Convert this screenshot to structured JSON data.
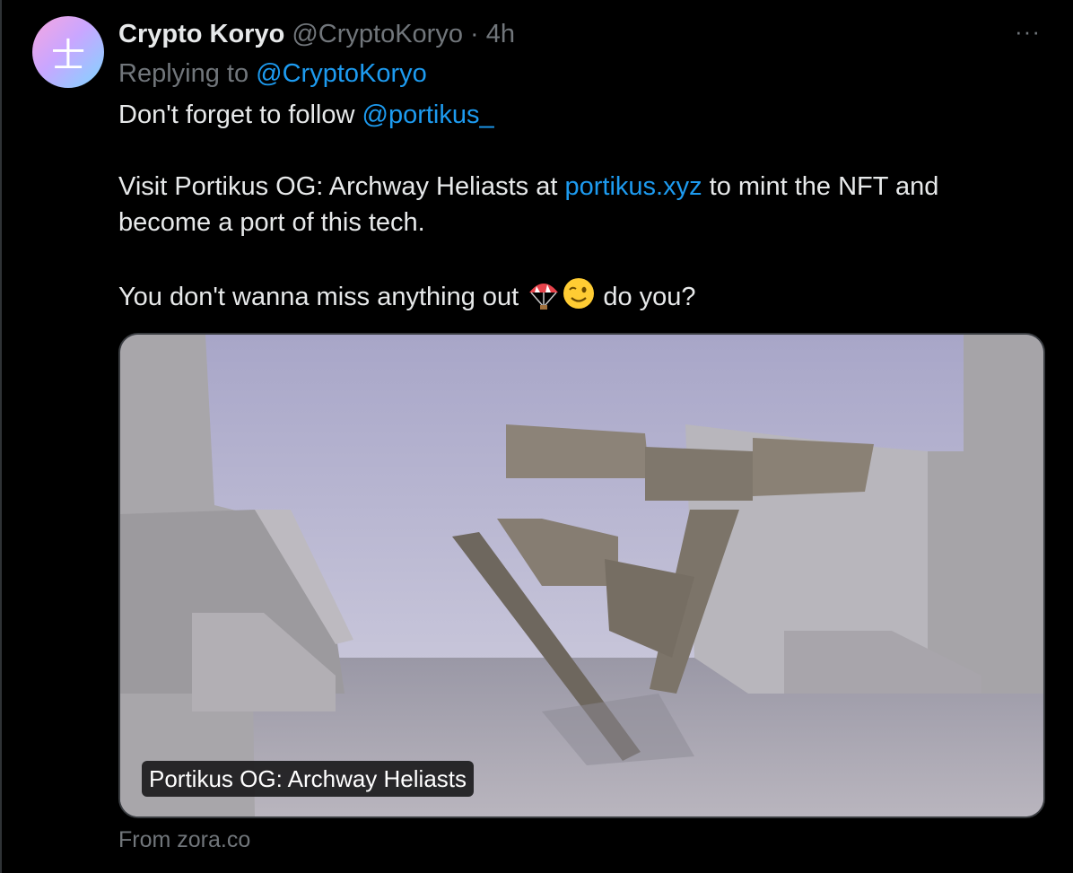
{
  "tweet": {
    "author_name": "Crypto Koryo",
    "author_handle": "@CryptoKoryo",
    "separator": "·",
    "time_ago": "4h",
    "more_label": "···",
    "avatar_glyph": "士",
    "replying_prefix": "Replying to",
    "replying_handle": "@CryptoKoryo",
    "line1_text": "Don't forget to follow ",
    "line1_mention": "@portikus_",
    "line2_text_a": "Visit Portikus OG: Archway Heliasts at ",
    "line2_link": "portikus.xyz",
    "line2_text_b": " to mint the NFT and become a port of this tech.",
    "line3_text_a": "You don't wanna miss anything out ",
    "line3_emoji_1": "parachute-emoji",
    "line3_emoji_2": "winking-face-emoji",
    "line3_text_b": " do you?"
  },
  "card": {
    "caption": "Portikus OG: Archway Heliasts",
    "source": "From zora.co"
  },
  "colors": {
    "background": "#000000",
    "text": "#e7e9ea",
    "muted": "#71767b",
    "link": "#1d9bf0"
  }
}
